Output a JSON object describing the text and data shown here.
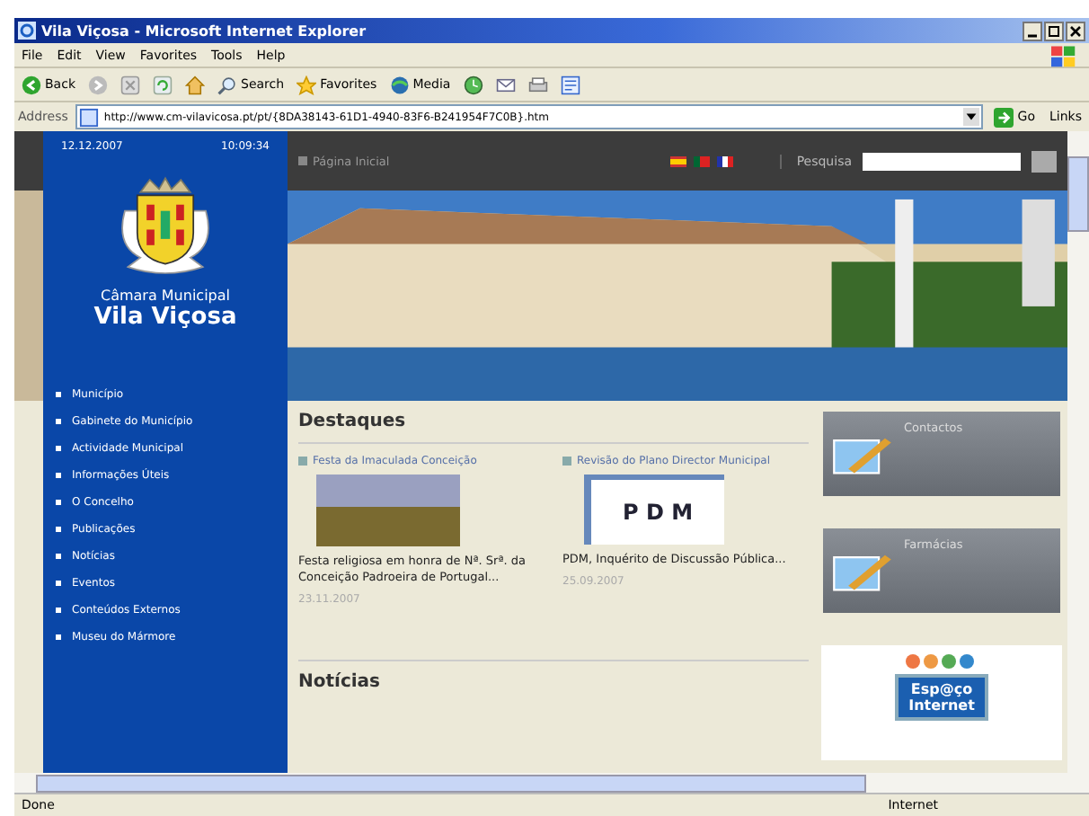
{
  "window": {
    "title": "Vila Viçosa - Microsoft Internet Explorer"
  },
  "menu": [
    "File",
    "Edit",
    "View",
    "Favorites",
    "Tools",
    "Help"
  ],
  "toolbar": [
    {
      "kind": "back",
      "label": "Back"
    },
    {
      "kind": "forward"
    },
    {
      "kind": "stop"
    },
    {
      "kind": "refresh"
    },
    {
      "kind": "home"
    },
    {
      "kind": "search",
      "label": "Search"
    },
    {
      "kind": "favorites",
      "label": "Favorites"
    },
    {
      "kind": "media",
      "label": "Media"
    },
    {
      "kind": "history"
    },
    {
      "kind": "mail"
    },
    {
      "kind": "print"
    },
    {
      "kind": "edit"
    }
  ],
  "address": {
    "label": "Address",
    "value": "http://www.cm-vilavicosa.pt/pt/{8DA38143-61D1-4940-83F6-B241954F7C0B}.htm",
    "go": "Go",
    "links": "Links"
  },
  "page": {
    "date": "12.12.2007",
    "time": "10:09:34",
    "home_link": "Página Inicial",
    "search_label": "Pesquisa",
    "council": "Câmara Municipal",
    "town": "Vila Viçosa",
    "nav": [
      "Município",
      "Gabinete do Município",
      "Actividade Municipal",
      "Informações Úteis",
      "O Concelho",
      "Publicações",
      "Notícias",
      "Eventos",
      "Conteúdos Externos",
      "Museu do Mármore"
    ],
    "highlights_title": "Destaques",
    "highlights": [
      {
        "kind": "photo",
        "title": "Festa da Imaculada Conceição",
        "text": "Festa religiosa em honra de Nª. Srª. da Conceição Padroeira de Portugal...",
        "date": "23.11.2007"
      },
      {
        "kind": "logo",
        "title": "Revisão do Plano Director Municipal",
        "text": "PDM, Inquérito de Discussão Pública...",
        "date": "25.09.2007",
        "logo": "P D M"
      }
    ],
    "news_title": "Notícias",
    "side_boxes": [
      "Contactos",
      "Farmácias"
    ],
    "banner": [
      "Esp@ço",
      "Internet"
    ]
  },
  "status_bar": {
    "text": "Done",
    "zone": "Internet"
  }
}
